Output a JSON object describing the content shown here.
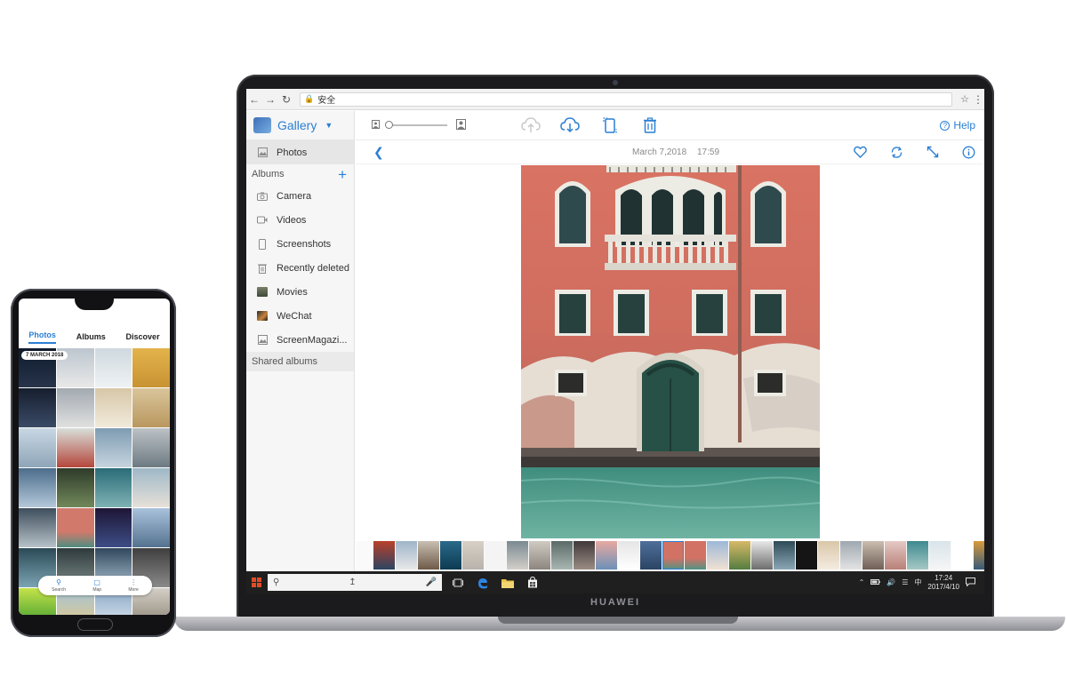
{
  "browser": {
    "security_label": "安全"
  },
  "sidebar": {
    "app_title": "Gallery",
    "photos_label": "Photos",
    "albums_label": "Albums",
    "items": [
      {
        "label": "Camera",
        "icon": "camera-icon"
      },
      {
        "label": "Videos",
        "icon": "video-icon"
      },
      {
        "label": "Screenshots",
        "icon": "phone-icon"
      },
      {
        "label": "Recently deleted",
        "icon": "trash-icon"
      },
      {
        "label": "Movies",
        "icon": "movies-thumbnail"
      },
      {
        "label": "WeChat",
        "icon": "wechat-thumbnail"
      },
      {
        "label": "ScreenMagazi...",
        "icon": "image-icon"
      }
    ],
    "shared_albums_label": "Shared albums"
  },
  "toolbar": {
    "help_label": "Help"
  },
  "viewer": {
    "date": "March 7,2018",
    "time": "17:59"
  },
  "taskbar": {
    "time": "17:24",
    "date": "2017/4/10"
  },
  "laptop": {
    "brand": "HUAWEI"
  },
  "phone": {
    "tabs": [
      "Photos",
      "Albums",
      "Discover"
    ],
    "date_chip": "7 MARCH 2018",
    "nav": [
      "Search",
      "Map",
      "More"
    ]
  },
  "colors": {
    "accent": "#2a7fd4",
    "sidebar_bg": "#f6f6f6",
    "taskbar_bg": "#1f1f1f"
  }
}
